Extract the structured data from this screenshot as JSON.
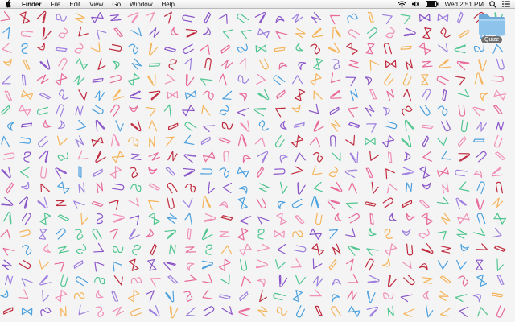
{
  "menubar": {
    "app_name": "Finder",
    "menus": [
      "File",
      "Edit",
      "View",
      "Go",
      "Window",
      "Help"
    ],
    "clock": "Wed 2:51 PM",
    "status_icons": [
      "wifi-icon",
      "volume-icon",
      "battery-icon",
      "spotlight-search-icon",
      "notification-center-icon"
    ]
  },
  "desktop": {
    "folder_label": "Quizz",
    "wallpaper": {
      "pattern": "scattered-paperclips",
      "background_color": "#f4f4f4",
      "colors": [
        "#e8699a",
        "#8a55c9",
        "#4fc58f",
        "#f5b45a",
        "#c02b3f",
        "#4aa0e0",
        "#9e7fe0",
        "#f08fb7"
      ]
    }
  }
}
